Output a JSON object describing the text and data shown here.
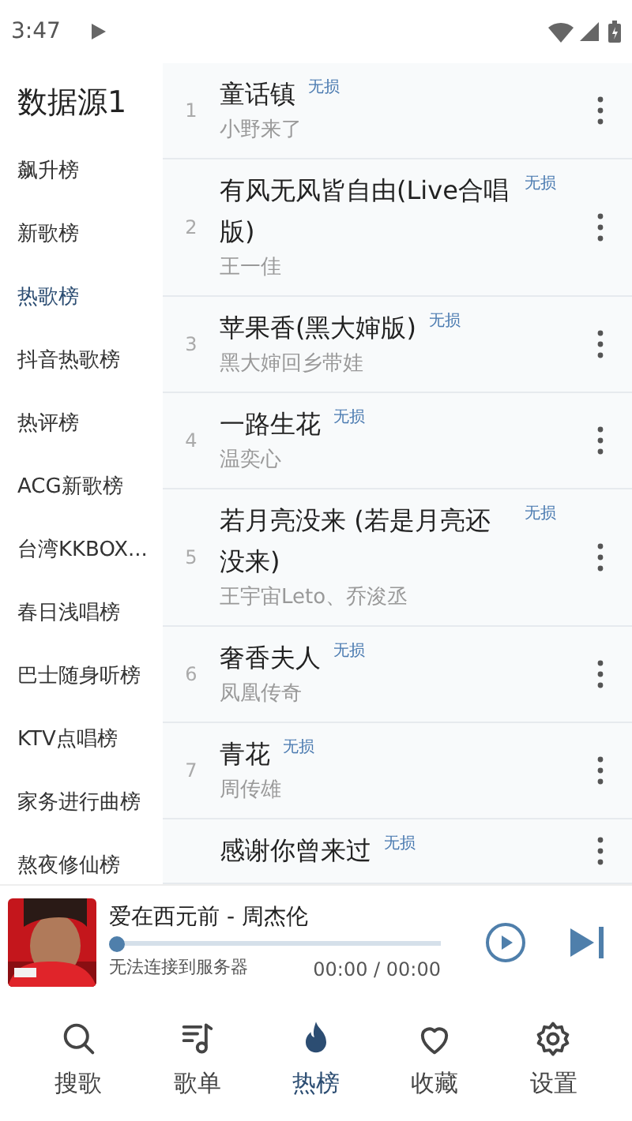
{
  "status_bar": {
    "time": "3:47"
  },
  "sidebar": {
    "title": "数据源1",
    "items": [
      {
        "label": "飙升榜",
        "selected": false
      },
      {
        "label": "新歌榜",
        "selected": false
      },
      {
        "label": "热歌榜",
        "selected": true
      },
      {
        "label": "抖音热歌榜",
        "selected": false
      },
      {
        "label": "热评榜",
        "selected": false
      },
      {
        "label": "ACG新歌榜",
        "selected": false
      },
      {
        "label": "台湾KKBOX...",
        "selected": false
      },
      {
        "label": "春日浅唱榜",
        "selected": false
      },
      {
        "label": "巴士随身听榜",
        "selected": false
      },
      {
        "label": "KTV点唱榜",
        "selected": false
      },
      {
        "label": "家务进行曲榜",
        "selected": false
      },
      {
        "label": "熬夜修仙榜",
        "selected": false
      }
    ]
  },
  "songs": [
    {
      "rank": "1",
      "title": "童话镇",
      "badge": "无损",
      "artist": "小野来了"
    },
    {
      "rank": "2",
      "title": "有风无风皆自由(Live合唱版)",
      "badge": "无损",
      "artist": "王一佳"
    },
    {
      "rank": "3",
      "title": "苹果香(黑大婶版)",
      "badge": "无损",
      "artist": "黑大婶回乡带娃"
    },
    {
      "rank": "4",
      "title": "一路生花",
      "badge": "无损",
      "artist": "温奕心"
    },
    {
      "rank": "5",
      "title": "若月亮没来 (若是月亮还没来)",
      "badge": "无损",
      "artist": "王宇宙Leto、乔浚丞"
    },
    {
      "rank": "6",
      "title": "奢香夫人",
      "badge": "无损",
      "artist": "凤凰传奇"
    },
    {
      "rank": "7",
      "title": "青花",
      "badge": "无损",
      "artist": "周传雄"
    },
    {
      "title": "感谢你曾来过",
      "badge": "无损"
    }
  ],
  "player": {
    "title": "爱在西元前 - 周杰伦",
    "status": "无法连接到服务器",
    "time": "00:00 / 00:00",
    "level": 0
  },
  "nav": [
    {
      "kind": "search",
      "label": "搜歌",
      "selected": false
    },
    {
      "kind": "playlist",
      "label": "歌单",
      "selected": false
    },
    {
      "kind": "hot",
      "label": "热榜",
      "selected": true
    },
    {
      "kind": "favorite",
      "label": "收藏",
      "selected": false
    },
    {
      "kind": "settings",
      "label": "设置",
      "selected": false
    }
  ]
}
